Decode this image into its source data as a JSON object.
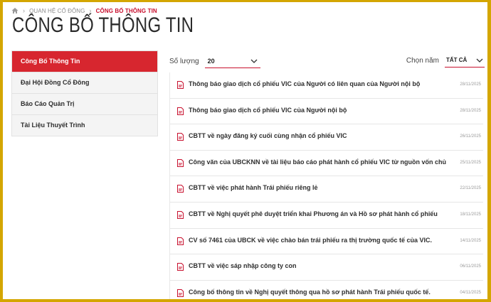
{
  "breadcrumb": {
    "home_icon": "home-icon",
    "parent": "QUAN HỆ CỔ ĐÔNG",
    "current": "CÔNG BỐ THÔNG TIN"
  },
  "page_title": "CÔNG BỐ THÔNG TIN",
  "sidebar": {
    "items": [
      {
        "label": "Công Bố Thông Tin",
        "active": true
      },
      {
        "label": "Đại Hội Đồng Cổ Đông",
        "active": false
      },
      {
        "label": "Báo Cáo Quản Trị",
        "active": false
      },
      {
        "label": "Tài Liệu Thuyết Trình",
        "active": false
      }
    ]
  },
  "controls": {
    "quantity_label": "Số lượng",
    "quantity_value": "20",
    "year_label": "Chọn năm",
    "year_value": "TẤT CẢ"
  },
  "documents": [
    {
      "title": "Thông báo giao dịch cổ phiếu VIC của Người có liên quan của Người nội bộ",
      "date": "28/11/2025"
    },
    {
      "title": "Thông báo giao dịch cổ phiếu VIC của Người nội bộ",
      "date": "28/11/2025"
    },
    {
      "title": "CBTT về ngày đăng ký cuối cùng nhận cổ phiếu VIC",
      "date": "26/11/2025"
    },
    {
      "title": "Công văn của UBCKNN về tài liệu báo cáo phát hành cổ phiếu VIC từ nguồn vốn chủ sở hữu",
      "date": "25/11/2025"
    },
    {
      "title": "CBTT về việc phát hành Trái phiếu riêng lẻ",
      "date": "22/11/2025"
    },
    {
      "title": "CBTT về Nghị quyết phê duyệt triển khai Phương án và Hồ sơ phát hành cổ phiếu",
      "date": "18/11/2025"
    },
    {
      "title": "CV số 7461 của UBCK về việc chào bán trái phiếu ra thị trường quốc tế của VIC.",
      "date": "14/11/2025"
    },
    {
      "title": "CBTT về việc sáp nhập công ty con",
      "date": "06/11/2025"
    },
    {
      "title": "Công bố thông tin về Nghị quyết thông qua hồ sơ phát hành Trái phiếu quốc tế.",
      "date": "04/11/2025"
    }
  ],
  "colors": {
    "accent": "#c8102e",
    "active_bg": "#d7262f",
    "frame_border": "#d4a600"
  }
}
